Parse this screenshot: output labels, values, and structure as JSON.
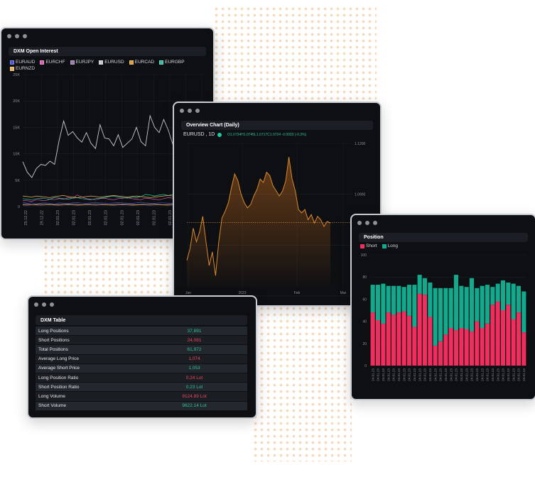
{
  "windows": {
    "open_interest": {
      "title": "DXM Open Interest",
      "legend": [
        {
          "label": "EURAUD",
          "color": "#4a56d6"
        },
        {
          "label": "EURCHF",
          "color": "#d660b0"
        },
        {
          "label": "EURJPY",
          "color": "#9a7bb0"
        },
        {
          "label": "EURUSD",
          "color": "#c7cbd1"
        },
        {
          "label": "EURCAD",
          "color": "#e0a13c"
        },
        {
          "label": "EURGBP",
          "color": "#30c0a0"
        },
        {
          "label": "EURNZD",
          "color": "#e8b45a"
        }
      ]
    },
    "overview": {
      "title": "Overview Chart (Daily)",
      "symbol": "EURUSD , 1D",
      "ohlc": "O1.0734H1.0745L1.0717C1.0724 -0.0003 (-0.3%)"
    },
    "position": {
      "title": "Position",
      "legend": [
        {
          "label": "Short",
          "color": "#f02e5e"
        },
        {
          "label": "Long",
          "color": "#13a98c"
        }
      ]
    },
    "table": {
      "title": "DXM Table",
      "rows": [
        {
          "label": "Long Positions",
          "value": "37,891",
          "color": "#2fc19a"
        },
        {
          "label": "Short Positions",
          "value": "24,081",
          "color": "#f0455f"
        },
        {
          "label": "Total Positions",
          "value": "61,972",
          "color": "#2fc19a"
        },
        {
          "label": "Average Long Price",
          "value": "1,074",
          "color": "#f0455f"
        },
        {
          "label": "Average Short Price",
          "value": "1,053",
          "color": "#2fc19a"
        },
        {
          "label": "Long Position Ratio",
          "value": "0.24 Lot",
          "color": "#f0455f"
        },
        {
          "label": "Short Position Ratio",
          "value": "0.23 Lot",
          "color": "#2fc19a"
        },
        {
          "label": "Long Volume",
          "value": "9124.89 Lot",
          "color": "#f0455f"
        },
        {
          "label": "Short Volume",
          "value": "9622.14 Lot",
          "color": "#2fc19a"
        }
      ]
    }
  },
  "chart_data": [
    {
      "type": "line",
      "title": "DXM Open Interest",
      "ylim": [
        0,
        25000
      ],
      "y_ticks": [
        "0",
        "5K",
        "10K",
        "15K",
        "20K",
        "25K"
      ],
      "x_ticks": [
        "25.12.22",
        "29.12.22",
        "02.01.23",
        "02.01.23",
        "02.01.23",
        "02.01.23",
        "02.01.23",
        "02.01.23",
        "02.01.23",
        "02.01.23",
        "02.01.23",
        "02.01.23"
      ],
      "series": [
        {
          "name": "EURUSD",
          "color": "#c7cbd1",
          "values": [
            8500,
            6500,
            5500,
            7200,
            8000,
            7800,
            8600,
            8000,
            12500,
            16200,
            13500,
            14200,
            13000,
            12200,
            14000,
            12000,
            11000,
            15500,
            13000,
            12800,
            11500,
            13600,
            11200,
            12000,
            12800,
            15000,
            12300,
            11500,
            17200,
            15000,
            14000,
            16500,
            14500,
            11800,
            15800,
            11200,
            12500,
            10500,
            13000,
            11500,
            12000
          ]
        },
        {
          "name": "EURAUD",
          "color": "#4a56d6",
          "values": [
            800,
            600,
            700,
            500,
            650,
            700,
            600,
            500,
            700,
            650,
            600,
            700,
            750,
            650,
            600,
            700,
            800,
            700,
            650,
            600,
            700,
            750,
            700,
            650,
            600,
            700,
            800,
            700,
            650,
            600,
            700,
            700,
            650,
            600,
            700,
            750,
            700,
            650,
            600,
            700,
            700
          ]
        },
        {
          "name": "EURCHF",
          "color": "#d660b0",
          "values": [
            1200,
            1100,
            1000,
            1300,
            1200,
            1100,
            1400,
            1300,
            1500,
            1400,
            1700,
            1600,
            2200,
            1800,
            1500,
            1400,
            1300,
            1500,
            1600,
            1400,
            1300,
            1500,
            1600,
            1700,
            1500,
            1400,
            1300,
            1600,
            1500,
            1400,
            1300,
            1500,
            1700,
            1600,
            1400,
            1500,
            1600,
            1400,
            1300,
            1500,
            1400
          ]
        },
        {
          "name": "EURJPY",
          "color": "#9a7bb0",
          "values": [
            300,
            250,
            350,
            300,
            250,
            300,
            350,
            300,
            250,
            300,
            350,
            300,
            250,
            300,
            350,
            300,
            250,
            300,
            350,
            300,
            250,
            300,
            350,
            300,
            250,
            300,
            350,
            300,
            250,
            300,
            350,
            300,
            250,
            300,
            350,
            300,
            250,
            300,
            350,
            300,
            250
          ]
        },
        {
          "name": "EURCAD",
          "color": "#e0a13c",
          "values": [
            400,
            450,
            350,
            400,
            500,
            450,
            400,
            350,
            400,
            450,
            500,
            450,
            400,
            350,
            400,
            450,
            500,
            450,
            400,
            350,
            400,
            450,
            500,
            450,
            400,
            350,
            400,
            450,
            500,
            450,
            400,
            350,
            400,
            450,
            500,
            450,
            400,
            350,
            400,
            450,
            500
          ]
        },
        {
          "name": "EURGBP",
          "color": "#30c0a0",
          "values": [
            1500,
            1400,
            1300,
            1500,
            1600,
            1500,
            1400,
            1700,
            1600,
            1500,
            1400,
            1600,
            1700,
            1500,
            1400,
            1300,
            1500,
            1600,
            1700,
            1900,
            2000,
            1800,
            1700,
            1600,
            1800,
            1700,
            1900,
            2300,
            2200,
            2000,
            2200,
            2300,
            2100,
            2300,
            2200,
            2100,
            2000,
            2200,
            2300,
            2100,
            2000
          ]
        },
        {
          "name": "EURNZD",
          "color": "#e8b45a",
          "values": [
            2000,
            1900,
            1800,
            2000,
            1900,
            1800,
            1700,
            1900,
            2000,
            2100,
            1900,
            1800,
            1700,
            1800,
            1900,
            2000,
            1900,
            1800,
            1900,
            2000,
            2100,
            2000,
            1900,
            1800,
            1900,
            2000,
            1900,
            1800,
            1700,
            1800,
            1900,
            2000,
            2100,
            2000,
            1900,
            1800,
            1900,
            2000,
            1900,
            1800,
            1900
          ]
        }
      ]
    },
    {
      "type": "area",
      "title": "Overview Chart (Daily)",
      "ylim": [
        1.035,
        1.12
      ],
      "y_ticks": [
        "1.1200",
        "1.0900",
        "1.0600",
        "1.0300"
      ],
      "x_ticks": [
        "Jan",
        "2023",
        "Feb",
        "Mar"
      ],
      "reference_line": 1.0734,
      "series": [
        {
          "name": "EURUSD , 1D",
          "color": "#d98a2c",
          "values": [
            1.051,
            1.058,
            1.07,
            1.062,
            1.068,
            1.077,
            1.062,
            1.048,
            1.056,
            1.042,
            1.062,
            1.076,
            1.08,
            1.085,
            1.094,
            1.102,
            1.098,
            1.09,
            1.085,
            1.082,
            1.084,
            1.089,
            1.093,
            1.099,
            1.097,
            1.103,
            1.101,
            1.095,
            1.092,
            1.089,
            1.092,
            1.098,
            1.112,
            1.099,
            1.092,
            1.081,
            1.079,
            1.081,
            1.075,
            1.078,
            1.073,
            1.077,
            1.075,
            1.071,
            1.074,
            1.073
          ]
        }
      ]
    },
    {
      "type": "bar",
      "title": "Position",
      "stacked": true,
      "ylim": [
        0,
        100
      ],
      "y_ticks": [
        "0",
        "20",
        "40",
        "60",
        "80",
        "100"
      ],
      "categories": [
        "24.01.23",
        "24.01.23",
        "24.01.23",
        "24.01.23",
        "24.01.23",
        "24.01.23",
        "24.01.23",
        "24.01.23",
        "24.01.23",
        "24.01.23",
        "24.01.23",
        "24.01.23",
        "24.01.23",
        "24.01.23",
        "24.01.23",
        "24.01.23",
        "24.01.23",
        "24.01.23",
        "24.01.23",
        "24.01.23",
        "24.01.23",
        "24.01.23",
        "24.01.23",
        "24.01.23",
        "24.01.23",
        "24.01.23",
        "24.01.23",
        "24.01.23",
        "24.01.23",
        "24.01.23"
      ],
      "series": [
        {
          "name": "Short",
          "color": "#f02e5e",
          "values": [
            48,
            41,
            38,
            48,
            46,
            48,
            49,
            45,
            35,
            65,
            64,
            44,
            18,
            22,
            28,
            34,
            32,
            34,
            33,
            31,
            40,
            34,
            38,
            55,
            58,
            50,
            55,
            42,
            48,
            30
          ]
        },
        {
          "name": "Long",
          "color": "#13a98c",
          "values": [
            25,
            32,
            36,
            24,
            26,
            24,
            22,
            28,
            38,
            17,
            15,
            31,
            52,
            48,
            42,
            36,
            50,
            38,
            38,
            48,
            30,
            38,
            35,
            16,
            16,
            27,
            20,
            32,
            24,
            37
          ]
        }
      ]
    }
  ]
}
